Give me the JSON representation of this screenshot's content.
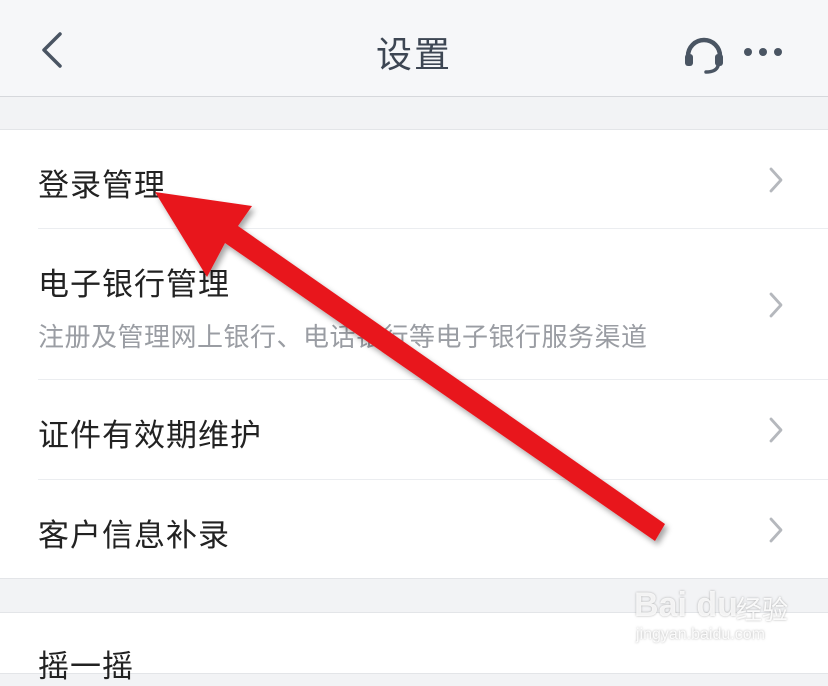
{
  "header": {
    "title": "设置",
    "back_icon": "chevron-left-icon",
    "support_icon": "headset-icon",
    "more_icon": "more-dots-icon"
  },
  "settings": {
    "items": [
      {
        "label": "登录管理",
        "icon": "chevron-right-icon"
      },
      {
        "label": "电子银行管理",
        "sublabel": "注册及管理网上银行、电话银行等电子银行服务渠道",
        "icon": "chevron-right-icon"
      },
      {
        "label": "证件有效期维护",
        "icon": "chevron-right-icon"
      },
      {
        "label": "客户信息补录",
        "icon": "chevron-right-icon"
      }
    ],
    "next_item": {
      "label": "摇一摇"
    }
  },
  "annotation": {
    "color": "#e8141c"
  },
  "watermark": {
    "brand": "Bai du",
    "text": "经验",
    "url": "jingyan.baidu.com"
  },
  "colors": {
    "header_bg": "#f6f7f9",
    "page_bg": "#f2f3f5",
    "icon": "#4a5563",
    "chevron": "#b5b8bd"
  }
}
